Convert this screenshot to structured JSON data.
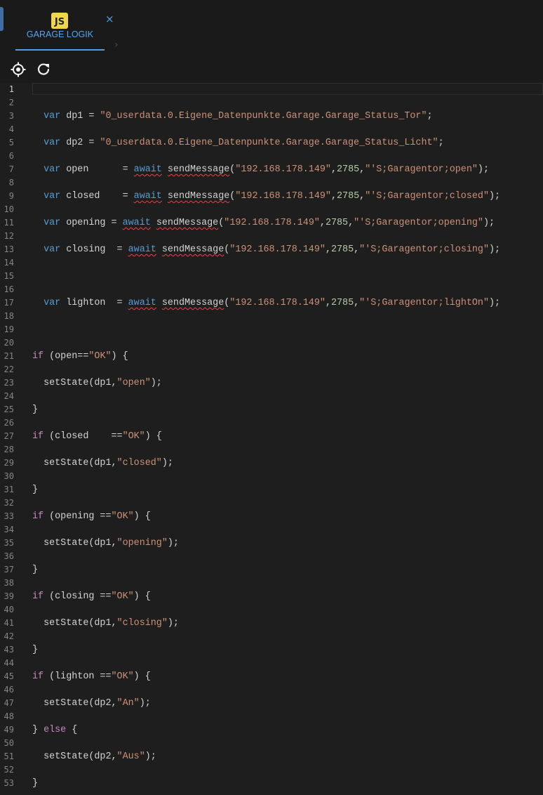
{
  "tab": {
    "badge": "JS",
    "title": "GARAGE LOGIK",
    "close": "×",
    "chevron": "›"
  },
  "toolbar": {
    "icons": [
      "target-icon",
      "refresh-icon"
    ]
  },
  "editor": {
    "current_line": 1,
    "lines": [
      [],
      [],
      [
        [
          "  ",
          ""
        ],
        [
          "var",
          "kw"
        ],
        [
          " dp1 = ",
          ""
        ],
        [
          "\"0_userdata.0.Eigene_Datenpunkte.Garage.Garage_Status_Tor\"",
          "str"
        ],
        [
          ";",
          ""
        ]
      ],
      [],
      [
        [
          "  ",
          ""
        ],
        [
          "var",
          "kw"
        ],
        [
          " dp2 = ",
          ""
        ],
        [
          "\"0_userdata.0.Eigene_Datenpunkte.Garage.Garage_Status_Licht\"",
          "str"
        ],
        [
          ";",
          ""
        ]
      ],
      [],
      [
        [
          "  ",
          ""
        ],
        [
          "var",
          "kw"
        ],
        [
          " open      = ",
          ""
        ],
        [
          "await",
          "kw squig"
        ],
        [
          " ",
          ""
        ],
        [
          "sendMessage",
          "squig"
        ],
        [
          "(",
          ""
        ],
        [
          "\"192.168.178.149\"",
          "str"
        ],
        [
          ",",
          ""
        ],
        [
          "2785",
          "num"
        ],
        [
          ",",
          ""
        ],
        [
          "\"'S;Garagentor;open\"",
          "str"
        ],
        [
          ");",
          ""
        ]
      ],
      [],
      [
        [
          "  ",
          ""
        ],
        [
          "var",
          "kw"
        ],
        [
          " closed    = ",
          ""
        ],
        [
          "await",
          "kw squig"
        ],
        [
          " ",
          ""
        ],
        [
          "sendMessage",
          "squig"
        ],
        [
          "(",
          ""
        ],
        [
          "\"192.168.178.149\"",
          "str"
        ],
        [
          ",",
          ""
        ],
        [
          "2785",
          "num"
        ],
        [
          ",",
          ""
        ],
        [
          "\"'S;Garagentor;closed\"",
          "str"
        ],
        [
          ");",
          ""
        ]
      ],
      [],
      [
        [
          "  ",
          ""
        ],
        [
          "var",
          "kw"
        ],
        [
          " opening = ",
          ""
        ],
        [
          "await",
          "kw squig"
        ],
        [
          " ",
          ""
        ],
        [
          "sendMessage",
          "squig"
        ],
        [
          "(",
          ""
        ],
        [
          "\"192.168.178.149\"",
          "str"
        ],
        [
          ",",
          ""
        ],
        [
          "2785",
          "num"
        ],
        [
          ",",
          ""
        ],
        [
          "\"'S;Garagentor;opening\"",
          "str"
        ],
        [
          ");",
          ""
        ]
      ],
      [],
      [
        [
          "  ",
          ""
        ],
        [
          "var",
          "kw"
        ],
        [
          " closing  = ",
          ""
        ],
        [
          "await",
          "kw squig"
        ],
        [
          " ",
          ""
        ],
        [
          "sendMessage",
          "squig"
        ],
        [
          "(",
          ""
        ],
        [
          "\"192.168.178.149\"",
          "str"
        ],
        [
          ",",
          ""
        ],
        [
          "2785",
          "num"
        ],
        [
          ",",
          ""
        ],
        [
          "\"'S;Garagentor;closing\"",
          "str"
        ],
        [
          ");",
          ""
        ]
      ],
      [],
      [],
      [],
      [
        [
          "  ",
          ""
        ],
        [
          "var",
          "kw"
        ],
        [
          " lighton  = ",
          ""
        ],
        [
          "await",
          "kw squig"
        ],
        [
          " ",
          ""
        ],
        [
          "sendMessage",
          "squig"
        ],
        [
          "(",
          ""
        ],
        [
          "\"192.168.178.149\"",
          "str"
        ],
        [
          ",",
          ""
        ],
        [
          "2785",
          "num"
        ],
        [
          ",",
          ""
        ],
        [
          "\"'S;Garagentor;lightOn\"",
          "str"
        ],
        [
          ");",
          ""
        ]
      ],
      [],
      [],
      [],
      [
        [
          "if",
          "ctl"
        ],
        [
          " (open==",
          ""
        ],
        [
          "\"OK\"",
          "str"
        ],
        [
          ") {",
          ""
        ]
      ],
      [],
      [
        [
          "  setState(dp1,",
          ""
        ],
        [
          "\"open\"",
          "str"
        ],
        [
          ");",
          ""
        ]
      ],
      [],
      [
        [
          "}",
          ""
        ]
      ],
      [],
      [
        [
          "if",
          "ctl"
        ],
        [
          " (closed    ==",
          ""
        ],
        [
          "\"OK\"",
          "str"
        ],
        [
          ") {",
          ""
        ]
      ],
      [],
      [
        [
          "  setState(dp1,",
          ""
        ],
        [
          "\"closed\"",
          "str"
        ],
        [
          ");",
          ""
        ]
      ],
      [],
      [
        [
          "}",
          ""
        ]
      ],
      [],
      [
        [
          "if",
          "ctl"
        ],
        [
          " (opening ==",
          ""
        ],
        [
          "\"OK\"",
          "str"
        ],
        [
          ") {",
          ""
        ]
      ],
      [],
      [
        [
          "  setState(dp1,",
          ""
        ],
        [
          "\"opening\"",
          "str"
        ],
        [
          ");",
          ""
        ]
      ],
      [],
      [
        [
          "}",
          ""
        ]
      ],
      [],
      [
        [
          "if",
          "ctl"
        ],
        [
          " (closing ==",
          ""
        ],
        [
          "\"OK\"",
          "str"
        ],
        [
          ") {",
          ""
        ]
      ],
      [],
      [
        [
          "  setState(dp1,",
          ""
        ],
        [
          "\"closing\"",
          "str"
        ],
        [
          ");",
          ""
        ]
      ],
      [],
      [
        [
          "}",
          ""
        ]
      ],
      [],
      [
        [
          "if",
          "ctl"
        ],
        [
          " (lighton ==",
          ""
        ],
        [
          "\"OK\"",
          "str"
        ],
        [
          ") {",
          ""
        ]
      ],
      [],
      [
        [
          "  setState(dp2,",
          ""
        ],
        [
          "\"An\"",
          "str"
        ],
        [
          ");",
          ""
        ]
      ],
      [],
      [
        [
          "} ",
          ""
        ],
        [
          "else",
          "ctl"
        ],
        [
          " {",
          ""
        ]
      ],
      [],
      [
        [
          "  setState(dp2,",
          ""
        ],
        [
          "\"Aus\"",
          "str"
        ],
        [
          ");",
          ""
        ]
      ],
      [],
      [
        [
          "}",
          ""
        ]
      ]
    ]
  }
}
